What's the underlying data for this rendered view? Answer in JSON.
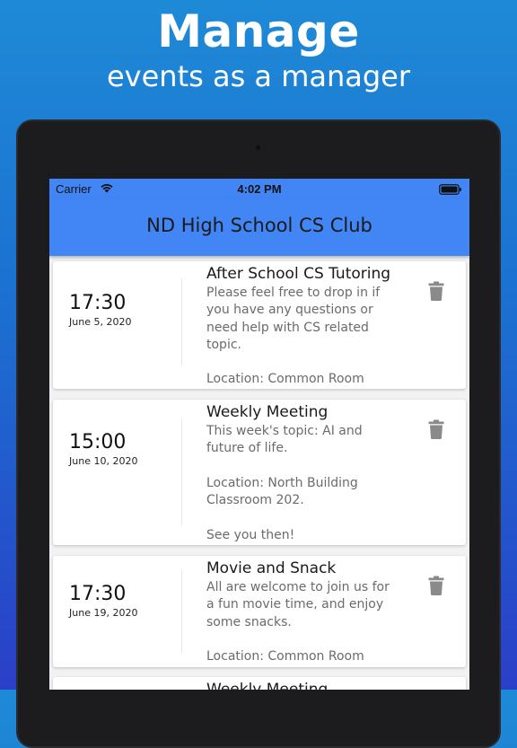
{
  "promo": {
    "headline": "Manage",
    "subheadline": "events as a manager"
  },
  "status_bar": {
    "carrier": "Carrier",
    "time": "4:02 PM",
    "icons": [
      "wifi-icon",
      "battery-icon"
    ]
  },
  "app_bar": {
    "title": "ND High School CS Club"
  },
  "events": [
    {
      "time": "17:30",
      "date": "June 5, 2020",
      "title": "After School CS Tutoring",
      "description": "Please feel free to drop in if\nyou have any questions or\nneed help with CS related\ntopic.\n\nLocation: Common Room",
      "action_icon": "trash-icon"
    },
    {
      "time": "15:00",
      "date": "June 10, 2020",
      "title": "Weekly Meeting",
      "description": "This week's topic: AI and\nfuture of life.\n\nLocation: North Building\nClassroom 202.\n\nSee you then!",
      "action_icon": "trash-icon"
    },
    {
      "time": "17:30",
      "date": "June 19, 2020",
      "title": "Movie and Snack",
      "description": "All are welcome to join us for\na fun movie time, and enjoy\nsome snacks.\n\nLocation: Common Room",
      "action_icon": "trash-icon"
    },
    {
      "time": "",
      "date": "",
      "title": "Weekly Meeting",
      "description": "",
      "action_icon": ""
    }
  ],
  "colors": {
    "app_bar": "#4285f4",
    "background_top": "#1e8ad6",
    "background_bottom": "#2a3fc8",
    "device_frame": "#1c1c1e",
    "trash_icon": "#8a8a8a"
  }
}
